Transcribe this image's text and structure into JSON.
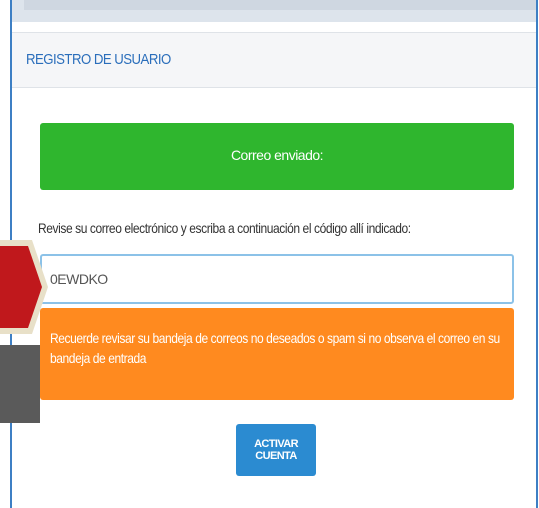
{
  "panel": {
    "title": "REGISTRO DE USUARIO"
  },
  "alert_success": {
    "text": "Correo enviado:"
  },
  "instruction": "Revise su correo electrónico y escriba a continuación el código allí indicado:",
  "code_input": {
    "value": "0EWDKO"
  },
  "alert_warning": {
    "text": "Recuerde revisar su bandeja de correos no deseados o spam si no observa el correo en su bandeja de entrada"
  },
  "activate_button": {
    "label": "ACTIVAR CUENTA"
  },
  "colors": {
    "accent": "#2a6ebb",
    "success": "#2fb62e",
    "warning": "#ff8a1f",
    "button": "#2b8bd1",
    "input_border": "#8cc2e8",
    "pointer_arrow": "#c0181c"
  },
  "icons": {
    "pointer": "red-arrow-icon"
  }
}
